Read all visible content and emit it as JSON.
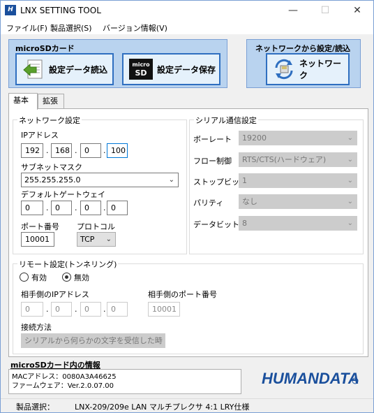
{
  "window": {
    "title": "LNX SETTING TOOL",
    "app_icon_text": "H",
    "minimize": "—",
    "maximize": "☐",
    "close": "✕"
  },
  "menu": {
    "file": "ファイル(F)",
    "product": "製品選択(S)",
    "version": "バージョン情報(V)"
  },
  "sd_group": {
    "title": "microSDカード",
    "read_label": "設定データ読込",
    "save_label": "設定データ保存",
    "sd_icon_top": "micro",
    "sd_icon_bottom": "SD"
  },
  "net_group": {
    "title": "ネットワークから設定/読込",
    "button_label": "ネットワーク"
  },
  "tabs": [
    {
      "label": "基本"
    },
    {
      "label": "拡張"
    }
  ],
  "network": {
    "title": "ネットワーク設定",
    "ip_label": "IPアドレス",
    "ip": [
      "192",
      "168",
      "0",
      "100"
    ],
    "subnet_label": "サブネットマスク",
    "subnet_value": "255.255.255.0",
    "gateway_label": "デフォルトゲートウェイ",
    "gateway": [
      "0",
      "0",
      "0",
      "0"
    ],
    "port_label": "ポート番号",
    "port_value": "10001",
    "protocol_label": "プロトコル",
    "protocol_value": "TCP",
    "sep": "."
  },
  "serial": {
    "title": "シリアル通信設定",
    "baud_label": "ボーレート",
    "baud_value": "19200",
    "flow_label": "フロー制御",
    "flow_value": "RTS/CTS(ハードウェア)",
    "stop_label": "ストップビット",
    "stop_value": "1",
    "parity_label": "パリティ",
    "parity_value": "なし",
    "data_label": "データビット",
    "data_value": "8"
  },
  "remote": {
    "title": "リモート設定(トンネリング)",
    "enable_label": "有効",
    "disable_label": "無効",
    "peer_ip_label": "相手側のIPアドレス",
    "peer_ip": [
      "0",
      "0",
      "0",
      "0"
    ],
    "peer_port_label": "相手側のポート番号",
    "peer_port_value": "10001",
    "connect_label": "接続方法",
    "connect_value": "シリアルから何らかの文字を受信した時"
  },
  "info": {
    "title": "microSDカード内の情報",
    "mac": "MACアドレス：0080A3A46625",
    "firmware": "ファームウェア：Ver.2.0.07.00"
  },
  "logo_text": "HUMANDATA",
  "status": {
    "label": "製品選択：",
    "value": "LNX-209/209e LAN マルチプレクサ 4:1 LRY仕様"
  },
  "colors": {
    "group_bg": "#b9d3ef",
    "button_border": "#2f6fc0",
    "logo": "#1a4f9c"
  }
}
